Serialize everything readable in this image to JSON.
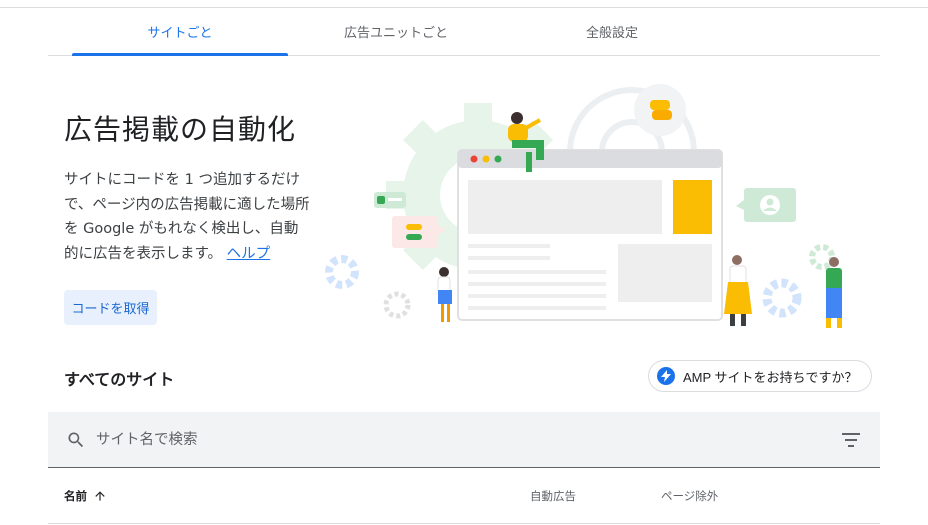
{
  "tabs": [
    {
      "label": "サイトごと",
      "active": true
    },
    {
      "label": "広告ユニットごと",
      "active": false
    },
    {
      "label": "全般設定",
      "active": false
    }
  ],
  "hero": {
    "title": "広告掲載の自動化",
    "description": "サイトにコードを 1 つ追加するだけで、ページ内の広告掲載に適した場所を Google がもれなく検出し、自動的に広告を表示します。",
    "help_link": "ヘルプ",
    "cta_label": "コードを取得"
  },
  "sites": {
    "title": "すべてのサイト",
    "amp_button": "AMP サイトをお持ちですか？",
    "search_placeholder": "サイト名で検索",
    "columns": {
      "name": "名前",
      "auto_ads": "自動広告",
      "page_exclusions": "ページ除外"
    }
  },
  "colors": {
    "accent": "#1a73e8",
    "button_bg": "#e8f0fe",
    "search_bg": "#f1f3f4"
  },
  "icons": {
    "search": "search-icon",
    "filter": "filter-icon",
    "amp": "lightning-bolt-icon",
    "sort": "arrow-up-icon"
  }
}
